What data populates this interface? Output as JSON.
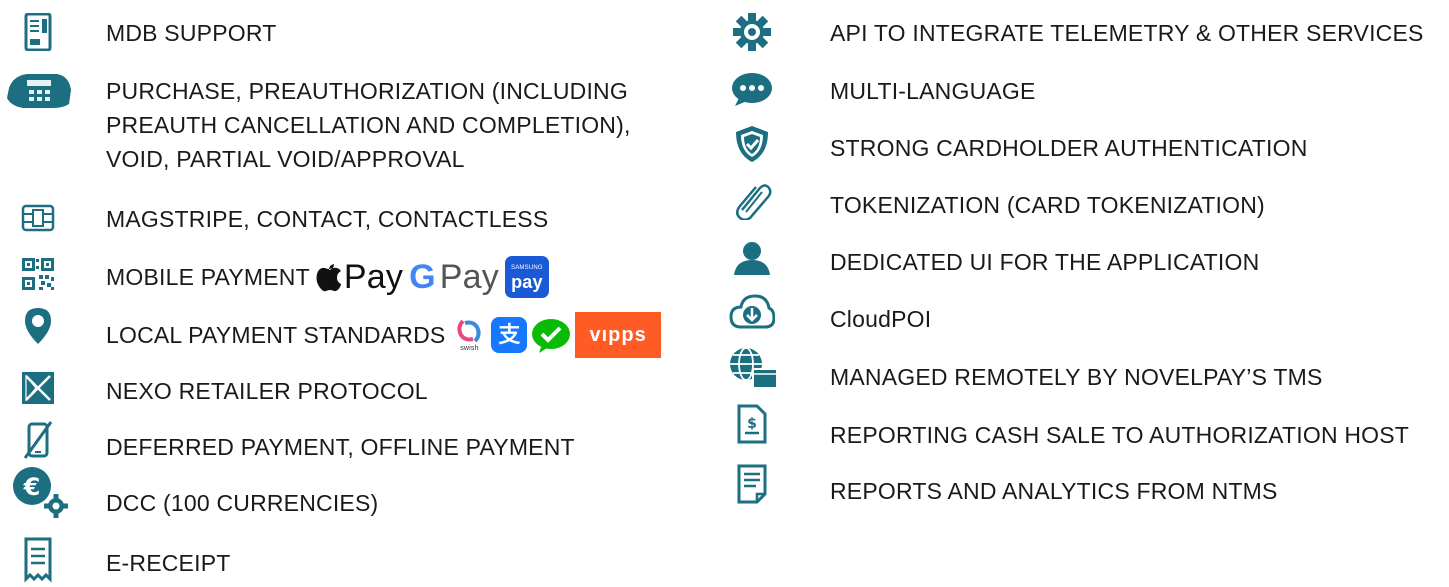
{
  "colors": {
    "icon_teal": "#1b6f80",
    "text": "#1a1a1a"
  },
  "left": [
    {
      "icon": "vending-machine-icon",
      "label": "MDB SUPPORT"
    },
    {
      "icon": "card-terminal-icon",
      "label": "PURCHASE, PREAUTHORIZATION (INCLUDING PREAUTH CANCELLATION  AND COMPLETION), VOID, PARTIAL VOID/APPROVAL"
    },
    {
      "icon": "chip-icon",
      "label": "MAGSTRIPE, CONTACT, CONTACTLESS"
    },
    {
      "icon": "qr-code-icon",
      "label": "MOBILE PAYMENT"
    },
    {
      "icon": "map-pin-icon",
      "label": "LOCAL PAYMENT STANDARDS"
    },
    {
      "icon": "nexo-icon",
      "label": "NEXO RETAILER PROTOCOL"
    },
    {
      "icon": "phone-offline-icon",
      "label": "DEFERRED PAYMENT, OFFLINE PAYMENT"
    },
    {
      "icon": "euro-gear-icon",
      "label": "DCC (100 CURRENCIES)"
    },
    {
      "icon": "receipt-icon",
      "label": "E-RECEIPT"
    }
  ],
  "right": [
    {
      "icon": "gear-icon",
      "label": "API TO INTEGRATE TELEMETRY & OTHER SERVICES"
    },
    {
      "icon": "chat-bubble-icon",
      "label": "MULTI-LANGUAGE"
    },
    {
      "icon": "shield-check-icon",
      "label": "STRONG CARDHOLDER AUTHENTICATION"
    },
    {
      "icon": "paperclip-icon",
      "label": "TOKENIZATION (CARD TOKENIZATION)"
    },
    {
      "icon": "user-icon",
      "label": "DEDICATED UI FOR THE APPLICATION"
    },
    {
      "icon": "cloud-download-icon",
      "label": "CloudPOI"
    },
    {
      "icon": "globe-screen-icon",
      "label": "MANAGED REMOTELY BY NOVELPAY’S TMS"
    },
    {
      "icon": "dollar-document-icon",
      "label": "REPORTING CASH SALE TO AUTHORIZATION HOST"
    },
    {
      "icon": "report-document-icon",
      "label": "REPORTS AND ANALYTICS FROM NTMS"
    }
  ],
  "mobile_logos": {
    "apple_pay": "Pay",
    "google_pay": "Pay",
    "samsung_top": "SAMSUNG",
    "samsung_bottom": "pay"
  },
  "local_logos": {
    "swish": "swish",
    "vipps": "vıpps"
  }
}
